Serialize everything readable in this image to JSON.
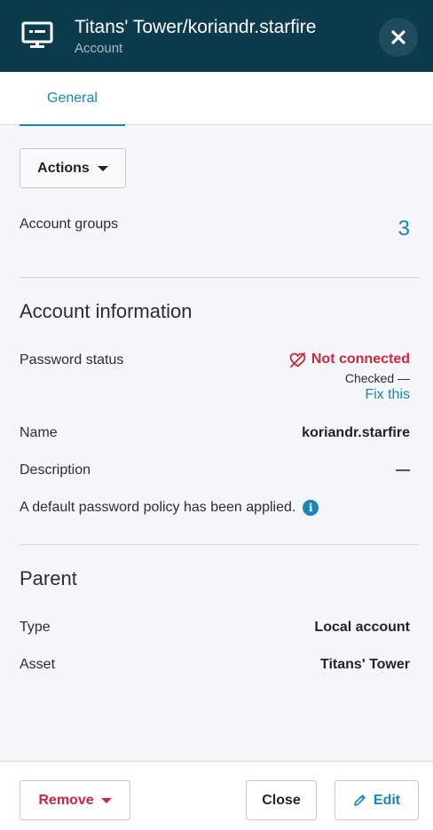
{
  "header": {
    "title": "Titans' Tower/koriandr.starfire",
    "subtitle": "Account",
    "icon": "monitor-icon",
    "close_icon": "close-icon"
  },
  "tabs": [
    {
      "label": "General",
      "active": true
    }
  ],
  "toolbar": {
    "actions_label": "Actions"
  },
  "account_groups": {
    "label": "Account groups",
    "count": "3"
  },
  "account_information": {
    "title": "Account information",
    "password_status_label": "Password status",
    "password_status_value": "Not connected",
    "checked_text": "Checked —",
    "fix_link": "Fix this",
    "name_label": "Name",
    "name_value": "koriandr.starfire",
    "description_label": "Description",
    "description_value": "—",
    "policy_text": "A default password policy has been applied."
  },
  "parent": {
    "title": "Parent",
    "type_label": "Type",
    "type_value": "Local account",
    "asset_label": "Asset",
    "asset_value": "Titans' Tower"
  },
  "footer": {
    "remove_label": "Remove",
    "close_label": "Close",
    "edit_label": "Edit"
  },
  "colors": {
    "header_bg": "#0c3b4c",
    "accent": "#1a86b6",
    "danger": "#d32638"
  }
}
